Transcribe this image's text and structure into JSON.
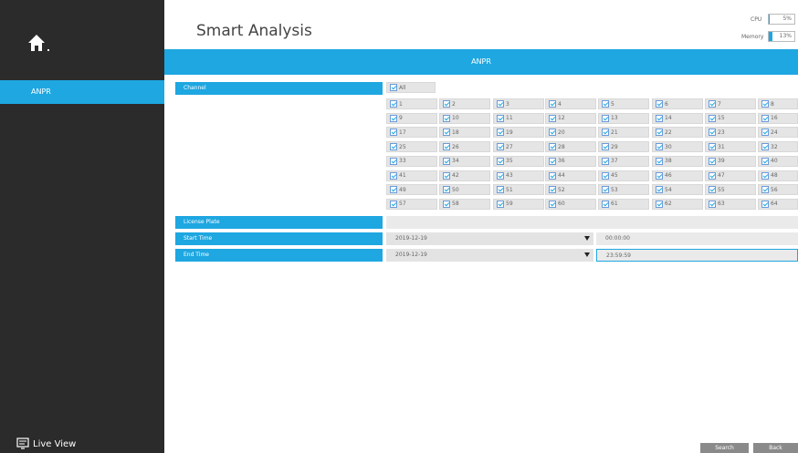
{
  "sidebar": {
    "home_icon": "home-icon",
    "items": [
      {
        "label": "ANPR"
      }
    ],
    "live_view_label": "Live View",
    "live_view_icon": "monitor-icon"
  },
  "header": {
    "title": "Smart Analysis",
    "cpu_label": "CPU",
    "cpu_value": "5%",
    "cpu_level": 0.05,
    "memory_label": "Memory",
    "memory_value": "13%",
    "memory_level": 0.13
  },
  "banner": {
    "title": "ANPR"
  },
  "form": {
    "channel_label": "Channel",
    "all_label": "All",
    "channels": [
      "1",
      "2",
      "3",
      "4",
      "5",
      "6",
      "7",
      "8",
      "9",
      "10",
      "11",
      "12",
      "13",
      "14",
      "15",
      "16",
      "17",
      "18",
      "19",
      "20",
      "21",
      "22",
      "23",
      "24",
      "25",
      "26",
      "27",
      "28",
      "29",
      "30",
      "31",
      "32",
      "33",
      "34",
      "35",
      "36",
      "37",
      "38",
      "39",
      "40",
      "41",
      "42",
      "43",
      "44",
      "45",
      "46",
      "47",
      "48",
      "49",
      "50",
      "51",
      "52",
      "53",
      "54",
      "55",
      "56",
      "57",
      "58",
      "59",
      "60",
      "61",
      "62",
      "63",
      "64"
    ],
    "license_plate_label": "License Plate",
    "license_plate_value": "",
    "start_time_label": "Start Time",
    "start_date": "2019-12-19",
    "start_time": "00:00:00",
    "end_time_label": "End Time",
    "end_date": "2019-12-19",
    "end_time": "23:59:59"
  },
  "buttons": {
    "search": "Search",
    "back": "Back"
  },
  "colors": {
    "accent": "#1ea7e1",
    "sidebar": "#2b2b2b",
    "button": "#8a8a8a"
  }
}
